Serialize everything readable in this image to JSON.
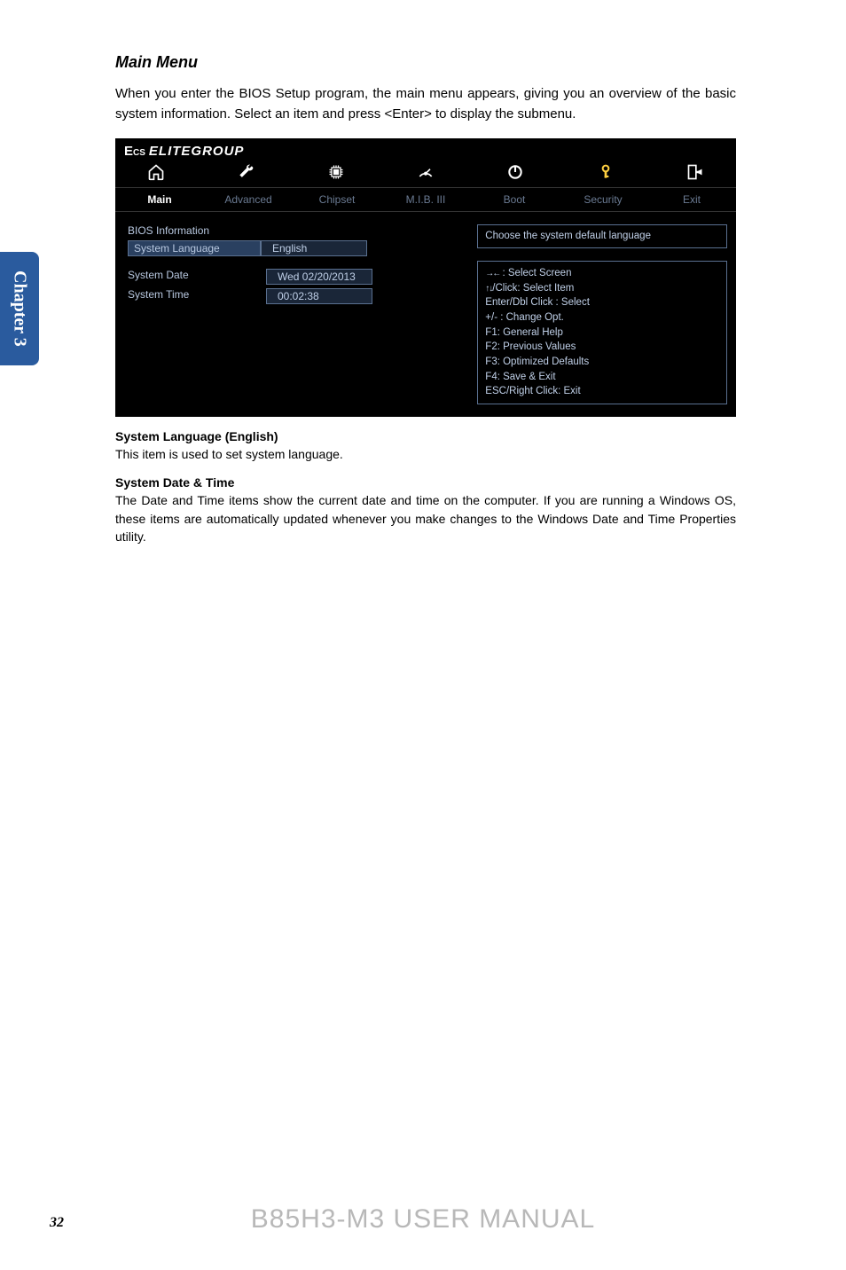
{
  "sideTab": "Chapter 3",
  "heading": "Main Menu",
  "intro": "When you enter the BIOS Setup program, the main menu appears, giving you an overview of the basic system information. Select an item and press <Enter> to display the submenu.",
  "bios": {
    "brand": "ELITEGROUP",
    "tabs": [
      "Main",
      "Advanced",
      "Chipset",
      "M.I.B. III",
      "Boot",
      "Security",
      "Exit"
    ],
    "activeTab": "Main",
    "rows": {
      "biosInfoLabel": "BIOS Information",
      "sysLangLabel": "System Language",
      "sysLangVal": "English",
      "sysDateLabel": "System Date",
      "sysDateVal": "Wed 02/20/2013",
      "sysTimeLabel": "System Time",
      "sysTimeVal": "00:02:38"
    },
    "helpTop": "Choose the system default language",
    "helpList": {
      "l1": " : Select Screen",
      "l2": "/Click: Select Item",
      "l3": "Enter/Dbl Click : Select",
      "l4": "+/- : Change Opt.",
      "l5": "F1: General Help",
      "l6": "F2: Previous Values",
      "l7": "F3: Optimized Defaults",
      "l8": "F4: Save & Exit",
      "l9": "ESC/Right Click: Exit"
    }
  },
  "section1": {
    "title": "System Language (English)",
    "body": "This item is used to set system language."
  },
  "section2": {
    "title": "System Date & Time",
    "body": "The Date and Time items show the current date and time on the computer. If you are running a Windows OS, these items are automatically updated whenever you make changes to the Windows Date and Time Properties utility."
  },
  "footer": "B85H3-M3 USER MANUAL",
  "pageNum": "32"
}
